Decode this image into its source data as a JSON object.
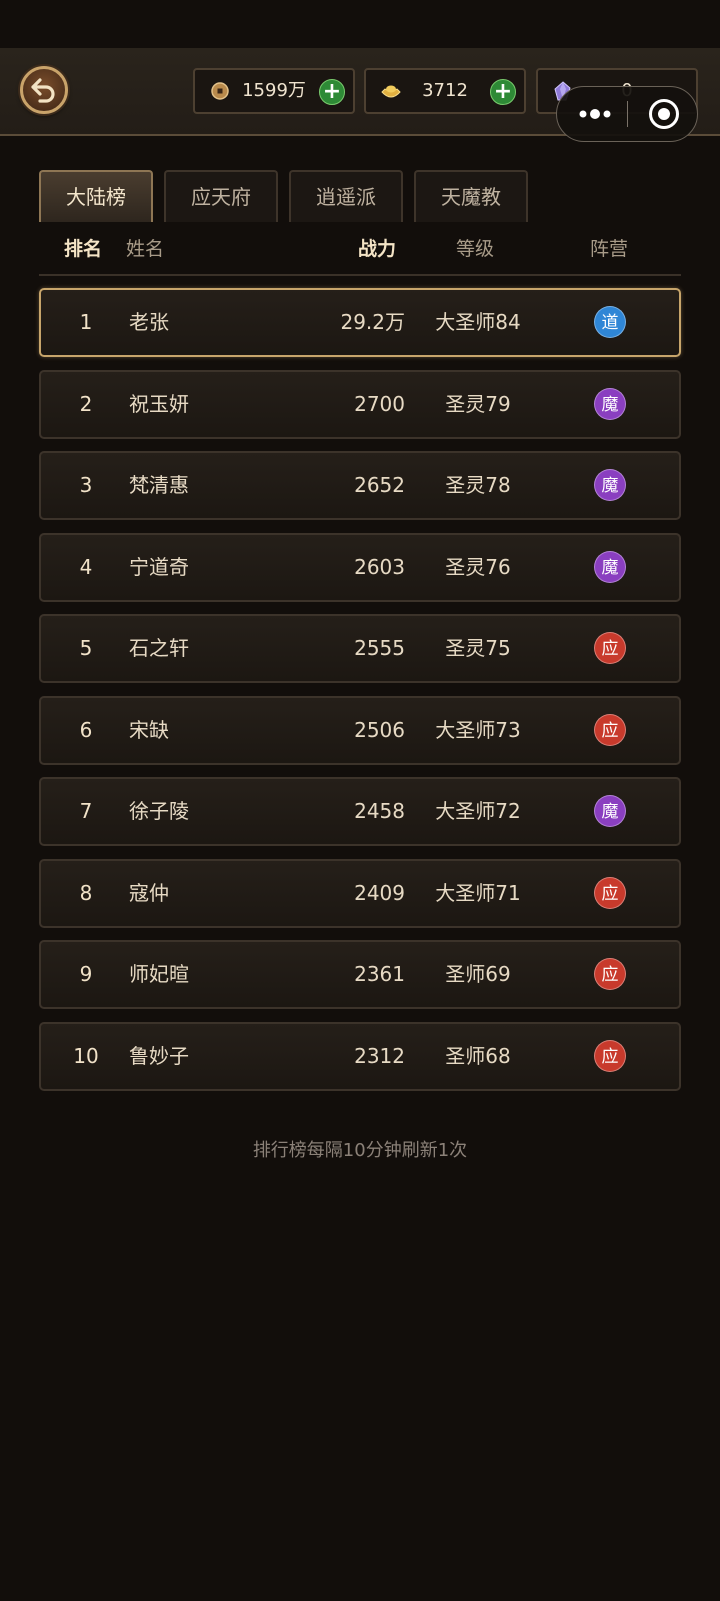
{
  "resources": {
    "copper": "1599万",
    "gold": "3712",
    "crystal": "0"
  },
  "tabs": [
    "大陆榜",
    "应天府",
    "逍遥派",
    "天魔教"
  ],
  "active_tab": 0,
  "columns": {
    "rank": "排名",
    "name": "姓名",
    "power": "战力",
    "level": "等级",
    "faction": "阵营"
  },
  "faction_colors": {
    "道": "#2f86d6",
    "魔": "#8a3fc0",
    "应": "#c83a2c"
  },
  "rows": [
    {
      "rank": "1",
      "name": "老张",
      "power": "29.2万",
      "level": "大圣师84",
      "faction": "道"
    },
    {
      "rank": "2",
      "name": "祝玉妍",
      "power": "2700",
      "level": "圣灵79",
      "faction": "魔"
    },
    {
      "rank": "3",
      "name": "梵清惠",
      "power": "2652",
      "level": "圣灵78",
      "faction": "魔"
    },
    {
      "rank": "4",
      "name": "宁道奇",
      "power": "2603",
      "level": "圣灵76",
      "faction": "魔"
    },
    {
      "rank": "5",
      "name": "石之轩",
      "power": "2555",
      "level": "圣灵75",
      "faction": "应"
    },
    {
      "rank": "6",
      "name": "宋缺",
      "power": "2506",
      "level": "大圣师73",
      "faction": "应"
    },
    {
      "rank": "7",
      "name": "徐子陵",
      "power": "2458",
      "level": "大圣师72",
      "faction": "魔"
    },
    {
      "rank": "8",
      "name": "寇仲",
      "power": "2409",
      "level": "大圣师71",
      "faction": "应"
    },
    {
      "rank": "9",
      "name": "师妃暄",
      "power": "2361",
      "level": "圣师69",
      "faction": "应"
    },
    {
      "rank": "10",
      "name": "鲁妙子",
      "power": "2312",
      "level": "圣师68",
      "faction": "应"
    }
  ],
  "footer_note": "排行榜每隔10分钟刷新1次"
}
